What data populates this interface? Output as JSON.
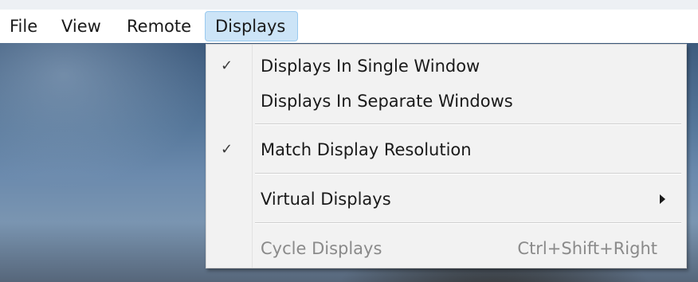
{
  "menubar": {
    "items": [
      {
        "label": "File"
      },
      {
        "label": "View"
      },
      {
        "label": "Remote"
      },
      {
        "label": "Displays",
        "active": true
      }
    ]
  },
  "dropdown": {
    "items": [
      {
        "label": "Displays In Single Window",
        "checked": true,
        "check_glyph": "✓"
      },
      {
        "label": "Displays In Separate Windows",
        "checked": false
      },
      {
        "label": "Match Display Resolution",
        "checked": true,
        "check_glyph": "✓"
      },
      {
        "label": "Virtual Displays",
        "has_submenu": true,
        "submenu_icon": "chevron-right-icon"
      },
      {
        "label": "Cycle Displays",
        "disabled": true,
        "shortcut": "Ctrl+Shift+Right"
      }
    ]
  },
  "colors": {
    "menubar_bg": "#ffffff",
    "active_menu_bg": "#cce4f7",
    "active_menu_border": "#99c9ef",
    "dropdown_bg": "#f2f2f2",
    "disabled_text": "#8a8a8a"
  }
}
